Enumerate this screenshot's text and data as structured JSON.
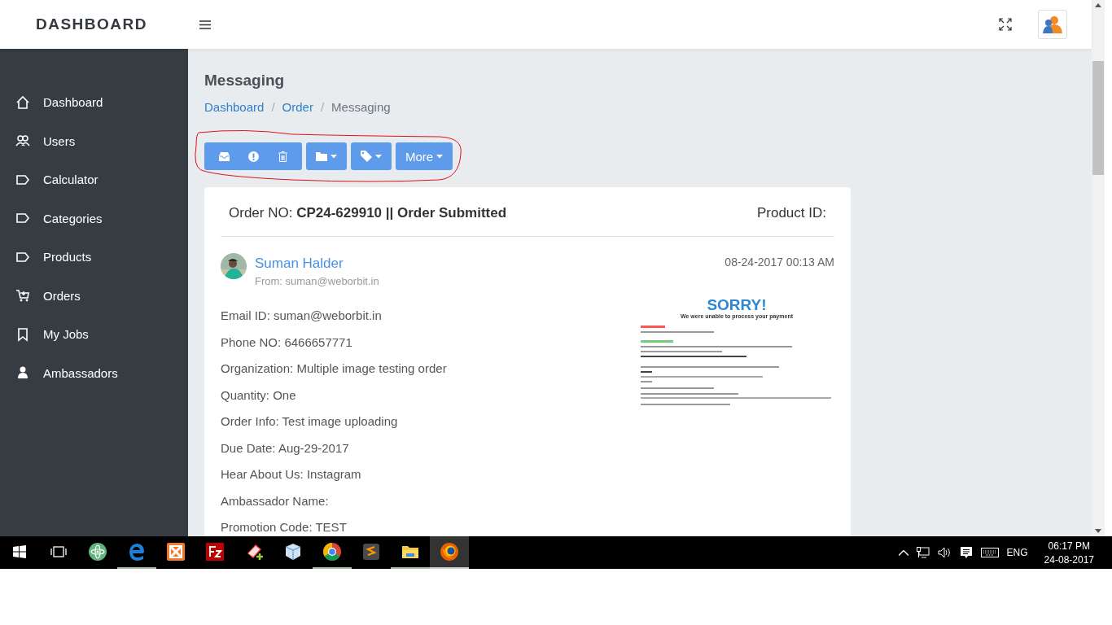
{
  "header": {
    "logo": "DASHBOARD"
  },
  "sidebar": {
    "items": [
      {
        "label": "Dashboard"
      },
      {
        "label": "Users"
      },
      {
        "label": "Calculator"
      },
      {
        "label": "Categories"
      },
      {
        "label": "Products"
      },
      {
        "label": "Orders"
      },
      {
        "label": "My Jobs"
      },
      {
        "label": "Ambassadors"
      }
    ]
  },
  "page": {
    "title": "Messaging",
    "breadcrumb_separator": "/",
    "breadcrumb": [
      {
        "label": "Dashboard",
        "kind": "link"
      },
      {
        "label": "Order",
        "kind": "link"
      },
      {
        "label": "Messaging",
        "kind": "current"
      }
    ]
  },
  "toolbar": {
    "more_label": "More"
  },
  "card": {
    "order": "Order NO: **CP24-629910 || Order Submitted**",
    "product_id": "Product ID:",
    "sender": {
      "name": "Suman Halder",
      "from": "From: suman@weborbit.in",
      "date": "08-24-2017 00:13 AM"
    },
    "fields": [
      "Email ID: suman@weborbit.in",
      "Phone NO: 6466657771",
      "Organization: Multiple image testing order",
      "Quantity: One",
      "Order Info: Test image uploading",
      "Due Date: Aug-29-2017",
      "Hear About Us: Instagram",
      "Ambassador Name:",
      "Promotion Code: TEST"
    ],
    "attachment": [
      {
        "kind": "title",
        "text": "SORRY!"
      },
      {
        "kind": "subtitle",
        "text": "We were unable to process your payment"
      }
    ]
  },
  "taskbar": {
    "apps": [
      {
        "running": false,
        "selected": false
      },
      {
        "running": true,
        "selected": false
      },
      {
        "running": false,
        "selected": false
      },
      {
        "running": false,
        "selected": false
      },
      {
        "running": false,
        "selected": false
      },
      {
        "running": false,
        "selected": false
      },
      {
        "running": true,
        "selected": false
      },
      {
        "running": false,
        "selected": false
      },
      {
        "running": true,
        "selected": false
      },
      {
        "running": true,
        "selected": true
      }
    ],
    "language": "ENG",
    "time": "06:17 PM",
    "date": "24-08-2017"
  }
}
